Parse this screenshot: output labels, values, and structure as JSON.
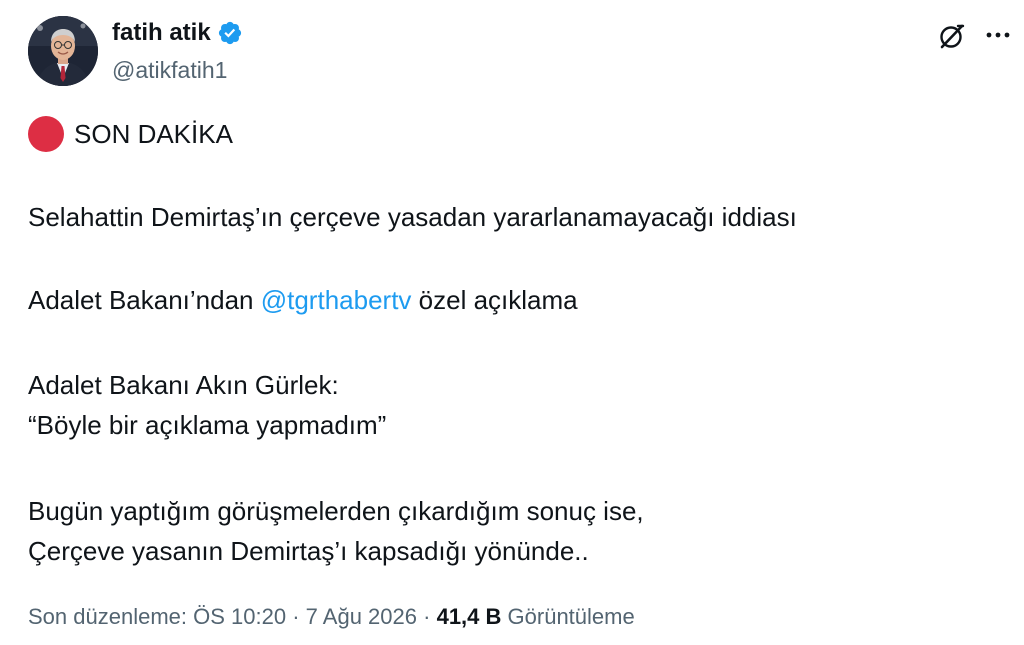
{
  "author": {
    "display_name": "fatih atik",
    "handle": "@atikfatih1",
    "verified": true,
    "verified_color": "#1d9bf0"
  },
  "header_icons": {
    "grok": "grok-icon",
    "more": "more-icon"
  },
  "tweet": {
    "badge_icon": "red-circle-icon",
    "badge_color": "#dd2e44",
    "breaking_label": "SON DAKİKA",
    "line1": "Selahattin Demirtaş’ın çerçeve yasadan yararlanamayacağı iddiası",
    "line2_before": "Adalet Bakanı’ndan ",
    "line2_mention": "@tgrthabertv",
    "line2_after": " özel açıklama",
    "line3": "Adalet Bakanı Akın Gürlek:",
    "line4": "“Böyle bir açıklama yapmadım”",
    "line5": "Bugün yaptığım görüşmelerden çıkardığım sonuç ise,",
    "line6": "Çerçeve yasanın Demirtaş’ı kapsadığı yönünde.."
  },
  "meta": {
    "edited_label": "Son düzenleme:",
    "time": "ÖS 10:20",
    "separator": "·",
    "date": "7 Ağu 2026",
    "views_count": "41,4 B",
    "views_label": "Görüntüleme"
  }
}
